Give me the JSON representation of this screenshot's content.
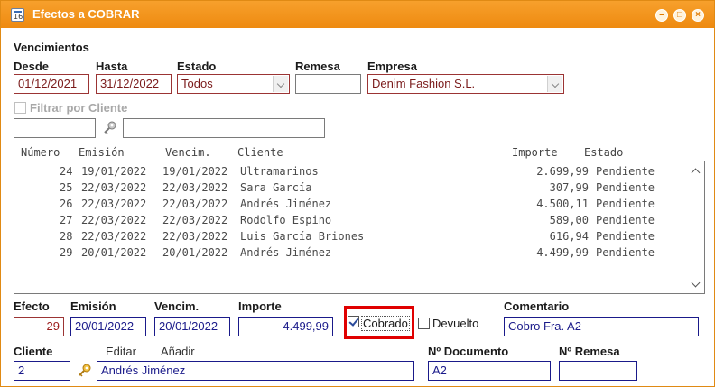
{
  "window": {
    "title": "Efectos a COBRAR"
  },
  "filters": {
    "section_title": "Vencimientos",
    "desde_label": "Desde",
    "desde_value": "01/12/2021",
    "hasta_label": "Hasta",
    "hasta_value": "31/12/2022",
    "estado_label": "Estado",
    "estado_value": "Todos",
    "remesa_label": "Remesa",
    "remesa_value": "",
    "empresa_label": "Empresa",
    "empresa_value": "Denim Fashion S.L.",
    "filtrar_cliente_label": "Filtrar por Cliente",
    "cliente_code_value": "",
    "cliente_name_value": ""
  },
  "list": {
    "headers": {
      "numero": "Número",
      "emision": "Emisión",
      "vencim": "Vencim.",
      "cliente": "Cliente",
      "importe": "Importe",
      "estado": "Estado"
    },
    "rows": [
      {
        "numero": "24",
        "emision": "19/01/2022",
        "vencim": "19/01/2022",
        "cliente": "Ultramarinos",
        "importe": "2.699,99",
        "estado": "Pendiente"
      },
      {
        "numero": "25",
        "emision": "22/03/2022",
        "vencim": "22/03/2022",
        "cliente": "Sara García",
        "importe": "307,99",
        "estado": "Pendiente"
      },
      {
        "numero": "26",
        "emision": "22/03/2022",
        "vencim": "22/03/2022",
        "cliente": "Andrés Jiménez",
        "importe": "4.500,11",
        "estado": "Pendiente"
      },
      {
        "numero": "27",
        "emision": "22/03/2022",
        "vencim": "22/03/2022",
        "cliente": "Rodolfo Espino",
        "importe": "589,00",
        "estado": "Pendiente"
      },
      {
        "numero": "28",
        "emision": "22/03/2022",
        "vencim": "22/03/2022",
        "cliente": "Luis García Briones",
        "importe": "616,94",
        "estado": "Pendiente"
      },
      {
        "numero": "29",
        "emision": "20/01/2022",
        "vencim": "20/01/2022",
        "cliente": "Andrés Jiménez",
        "importe": "4.499,99",
        "estado": "Pendiente"
      }
    ]
  },
  "detail": {
    "efecto_label": "Efecto",
    "efecto_value": "29",
    "emision_label": "Emisión",
    "emision_value": "20/01/2022",
    "vencim_label": "Vencim.",
    "vencim_value": "20/01/2022",
    "importe_label": "Importe",
    "importe_value": "4.499,99",
    "cobrado_label": "Cobrado",
    "devuelto_label": "Devuelto",
    "comentario_label": "Comentario",
    "comentario_value": "Cobro Fra. A2",
    "cliente_label": "Cliente",
    "editar_label": "Editar",
    "anadir_label": "Añadir",
    "cliente_code_value": "2",
    "cliente_name_value": "Andrés Jiménez",
    "ndocumento_label": "Nº Documento",
    "ndocumento_value": "A2",
    "nremesa_label": "Nº Remesa",
    "nremesa_value": ""
  }
}
